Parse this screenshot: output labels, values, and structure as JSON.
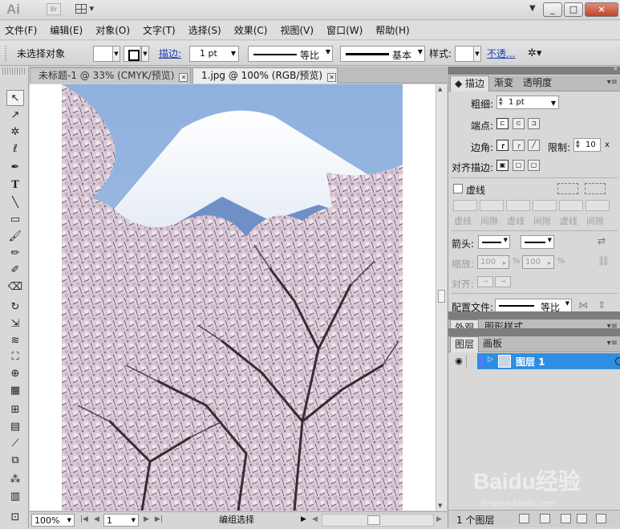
{
  "titlebar": {
    "app_logo": "Ai",
    "bridge_badge": "Br",
    "window_controls": [
      "_",
      "□",
      "×"
    ]
  },
  "menu": [
    "文件(F)",
    "编辑(E)",
    "对象(O)",
    "文字(T)",
    "选择(S)",
    "效果(C)",
    "视图(V)",
    "窗口(W)",
    "帮助(H)"
  ],
  "control_bar": {
    "selection_status": "未选择对象",
    "stroke_label": "描边:",
    "stroke_weight": "1 pt",
    "profile_label": "等比",
    "brush_label": "基本",
    "style_label": "样式:",
    "opacity_link": "不透..."
  },
  "doc_tabs": [
    {
      "label": "未标题-1 @ 33% (CMYK/预览)",
      "active": false
    },
    {
      "label": "1.jpg @ 100% (RGB/预览)",
      "active": true
    }
  ],
  "status_bar": {
    "zoom": "100%",
    "artboard_index": "1",
    "status_text": "编组选择"
  },
  "stroke_panel": {
    "tabs": [
      "描边",
      "渐变",
      "透明度"
    ],
    "weight_label": "粗细:",
    "weight_value": "1 pt",
    "cap_label": "端点:",
    "corner_label": "边角:",
    "limit_label": "限制:",
    "limit_value": "10",
    "limit_unit": "x",
    "align_label": "对齐描边:",
    "dashed_label": "虚线",
    "dash_labels": [
      "虚线",
      "间隙",
      "虚线",
      "间隙",
      "虚线",
      "间隙"
    ],
    "arrow_label": "箭头:",
    "scale_label": "缩放:",
    "scale_value_1": "100",
    "scale_value_2": "100",
    "percent": "%",
    "align_arrow_label": "对齐:",
    "profile_label": "配置文件:",
    "profile_value": "等比"
  },
  "appearance_panel": {
    "tabs": [
      "外观",
      "图形样式"
    ]
  },
  "layers_panel": {
    "tabs": [
      "图层",
      "画板"
    ],
    "layer_name": "图层 1",
    "footer_count": "1 个图层"
  },
  "watermark": {
    "text": "Baidu经验",
    "sub": "jingyan.baidu.com"
  },
  "colors": {
    "selection_blue": "#2e8ee3",
    "link_blue": "#1b3fb3",
    "close_red": "#c0432c"
  }
}
